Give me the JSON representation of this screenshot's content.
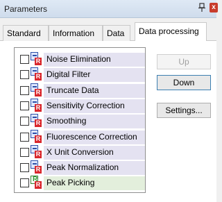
{
  "window": {
    "title": "Parameters",
    "close_glyph": "x"
  },
  "tabs": [
    {
      "label": "Standard",
      "active": false
    },
    {
      "label": "Information",
      "active": false
    },
    {
      "label": "Data",
      "active": false
    },
    {
      "label": "Data processing",
      "active": true
    }
  ],
  "processing_list": [
    {
      "label": "Noise Elimination",
      "checked": false,
      "badge": "R",
      "icon": "blue-doc"
    },
    {
      "label": "Digital Filter",
      "checked": false,
      "badge": "R",
      "icon": "blue-doc"
    },
    {
      "label": "Truncate Data",
      "checked": false,
      "badge": "R",
      "icon": "blue-doc"
    },
    {
      "label": "Sensitivity Correction",
      "checked": false,
      "badge": "R",
      "icon": "blue-doc"
    },
    {
      "label": "Smoothing",
      "checked": false,
      "badge": "R",
      "icon": "blue-doc"
    },
    {
      "label": "Fluorescence Correction",
      "checked": false,
      "badge": "R",
      "icon": "blue-doc"
    },
    {
      "label": "X Unit Conversion",
      "checked": false,
      "badge": "R",
      "icon": "blue-doc"
    },
    {
      "label": "Peak Normalization",
      "checked": false,
      "badge": "R",
      "icon": "blue-doc"
    },
    {
      "label": "Peak Picking",
      "checked": false,
      "badge": "R",
      "icon": "green-doc",
      "doc_letter": "R"
    }
  ],
  "buttons": {
    "up": "Up",
    "down": "Down",
    "settings": "Settings..."
  },
  "colors": {
    "row_purple": "#e4e2f1",
    "row_green": "#e3efdc",
    "badge_red": "#d9262c"
  }
}
